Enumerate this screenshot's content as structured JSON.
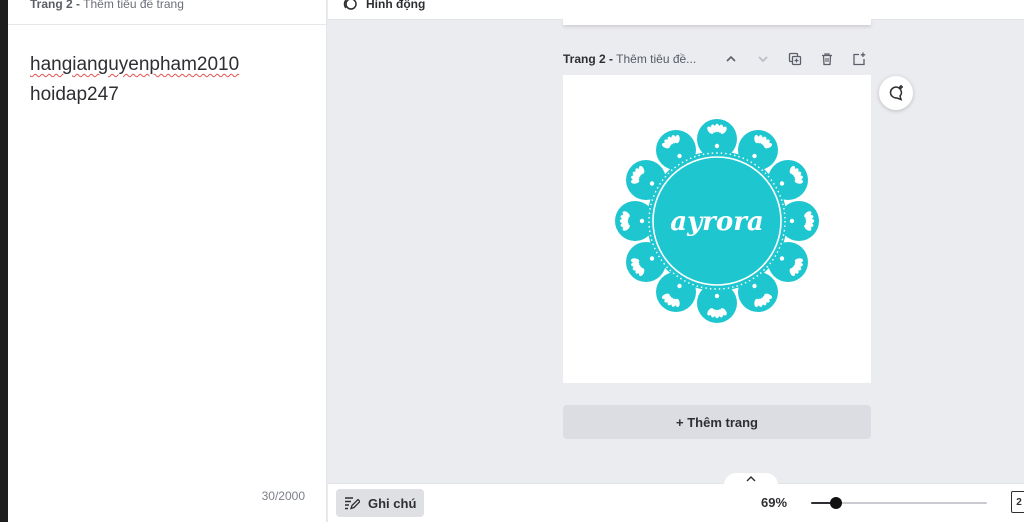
{
  "notes_panel": {
    "header_page": "Trang 2 -",
    "header_title": "Thêm tiêu đề trang",
    "lines": [
      "hangianguyenpham2010",
      "hoidap247"
    ],
    "char_count": "30/2000"
  },
  "toolbar": {
    "animate_label": "Hình động"
  },
  "page_header": {
    "page": "Trang 2 -",
    "title": "Thêm tiêu đề..."
  },
  "canvas": {
    "logo_text": "ayrora",
    "logo_color": "#1ec6cf",
    "icon": "lace-badge-logo"
  },
  "add_page_label": "+ Thêm trang",
  "bottom": {
    "notes_label": "Ghi chú",
    "zoom_label": "69%",
    "zoom_fraction": 0.14,
    "page_count": "2"
  }
}
